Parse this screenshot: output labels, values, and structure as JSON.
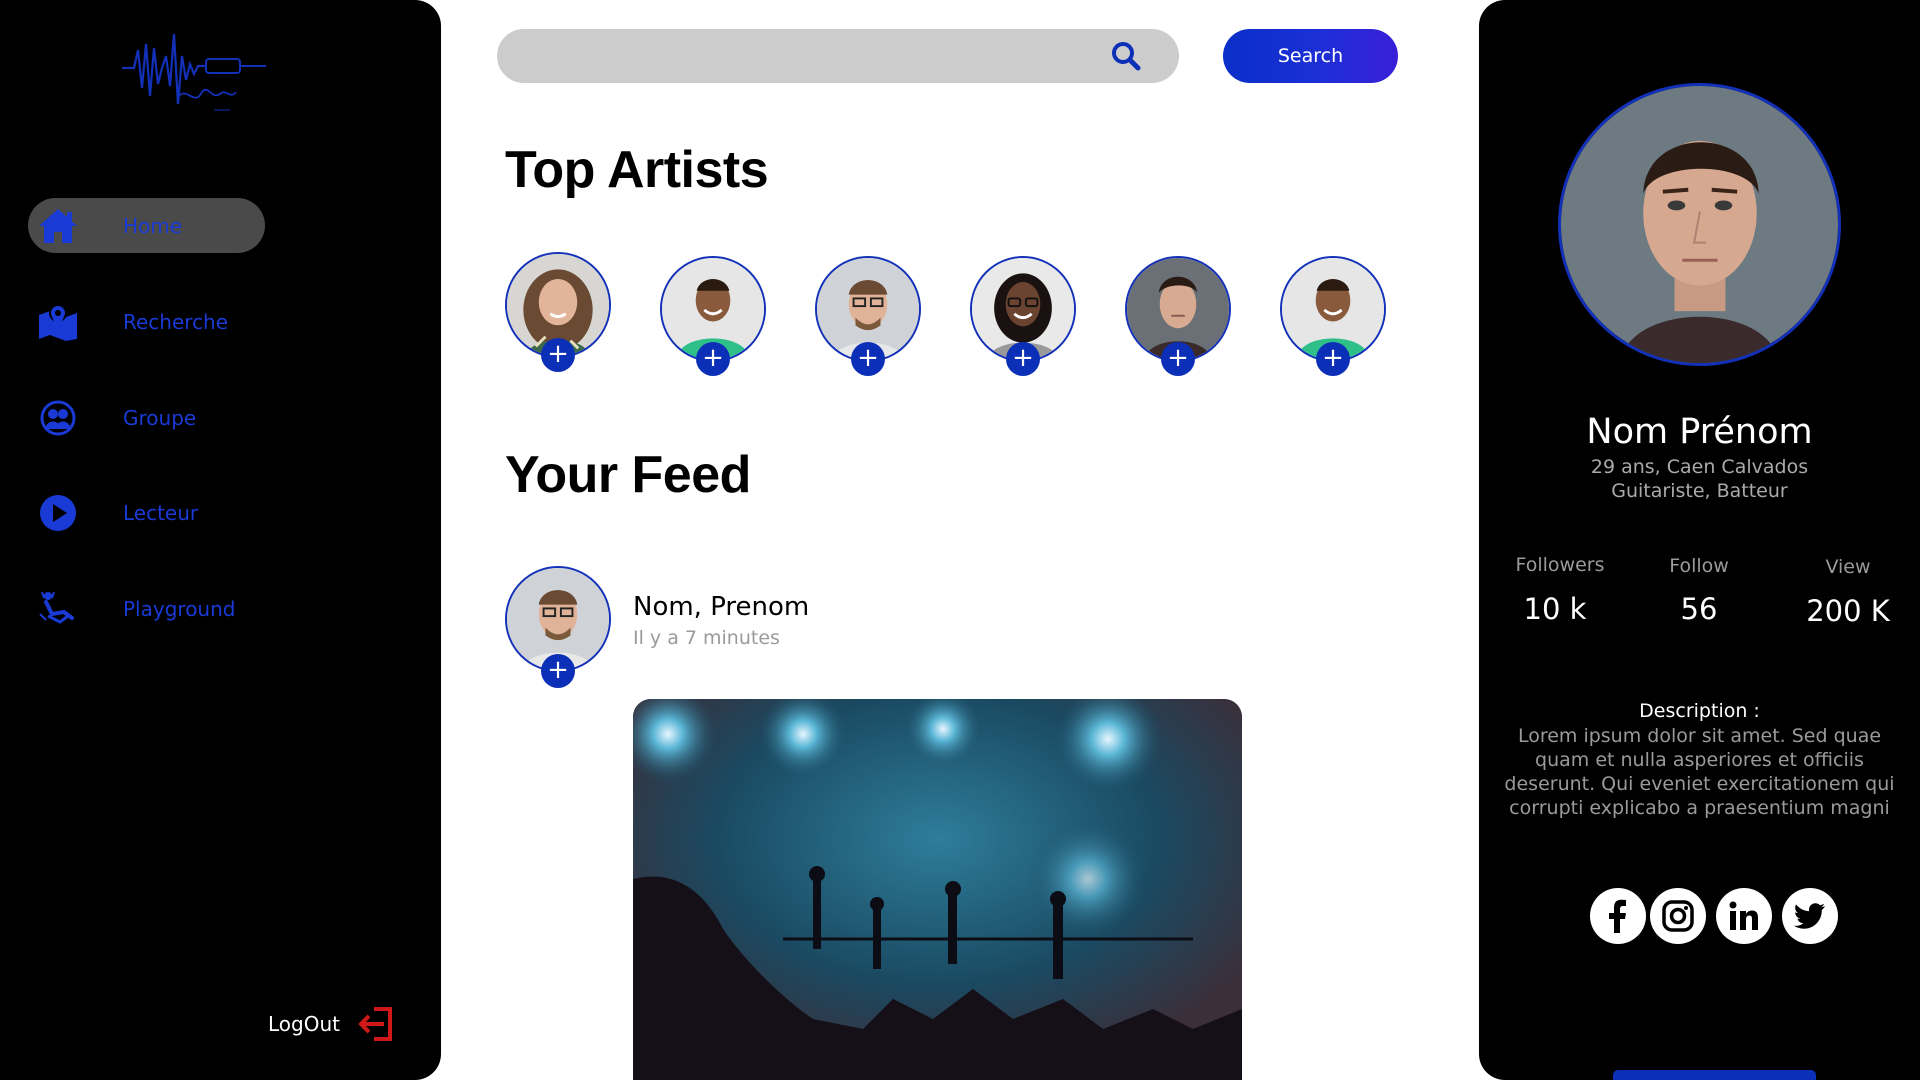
{
  "brand": {
    "logo_icon": "wave-studio-logo"
  },
  "sidebar": {
    "items": [
      {
        "label": "Home",
        "icon": "home-icon",
        "active": true
      },
      {
        "label": "Recherche",
        "icon": "map-pin-icon",
        "active": false
      },
      {
        "label": "Groupe",
        "icon": "group-icon",
        "active": false
      },
      {
        "label": "Lecteur",
        "icon": "play-icon",
        "active": false
      },
      {
        "label": "Playground",
        "icon": "swing-icon",
        "active": false
      }
    ],
    "logout_label": "LogOut"
  },
  "search": {
    "placeholder": "",
    "button_label": "Search"
  },
  "top_artists": {
    "title": "Top Artists",
    "add_label": "+"
  },
  "feed": {
    "title": "Your Feed",
    "post": {
      "author": "Nom, Prenom",
      "time": "Il y a 7 minutes",
      "add_label": "+"
    }
  },
  "profile": {
    "name": "Nom Prénom",
    "info_line1": "29 ans, Caen Calvados",
    "info_line2": "Guitariste, Batteur",
    "stats": [
      {
        "label": "Followers",
        "value": "10 k"
      },
      {
        "label": "Follow",
        "value": "56"
      },
      {
        "label": "View",
        "value": "200 K"
      }
    ],
    "description_title": "Description :",
    "description_lines": [
      "Lorem ipsum dolor sit amet. Sed quae",
      "quam et nulla asperiores et officiis",
      "deserunt. Qui eveniet exercitationem qui",
      "corrupti explicabo a praesentium magni"
    ],
    "socials": [
      "facebook-icon",
      "instagram-icon",
      "linkedin-icon",
      "twitter-icon"
    ]
  },
  "colors": {
    "accent": "#0c2fb8",
    "nav_text": "#1a3ad6",
    "logout": "#d01818",
    "sidebar_bg": "#000000",
    "active_bg": "#4a4a4a"
  }
}
